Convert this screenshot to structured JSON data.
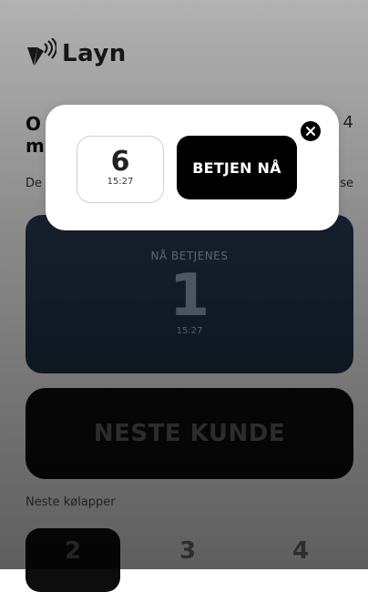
{
  "header": {
    "logo_text": "Layn"
  },
  "page": {
    "title_partial": "O",
    "title_partial_line2": "m",
    "title_right_fragment": "4",
    "description_partial": "De",
    "description_right_fragment": "se"
  },
  "serving": {
    "label": "NÅ BETJENES",
    "number": "1",
    "time": "15:27"
  },
  "next_button": {
    "label": "NESTE KUNDE"
  },
  "queue": {
    "label": "Neste kølapper",
    "items": [
      "2",
      "3",
      "4"
    ]
  },
  "modal": {
    "ticket_number": "6",
    "ticket_time": "15:27",
    "serve_label": "BETJEN NÅ"
  },
  "icons": {
    "logo": "layn-logo-icon",
    "close": "close-icon"
  },
  "colors": {
    "serving_card": "#24364b",
    "primary": "#000000",
    "modal_bg": "#ffffff"
  }
}
